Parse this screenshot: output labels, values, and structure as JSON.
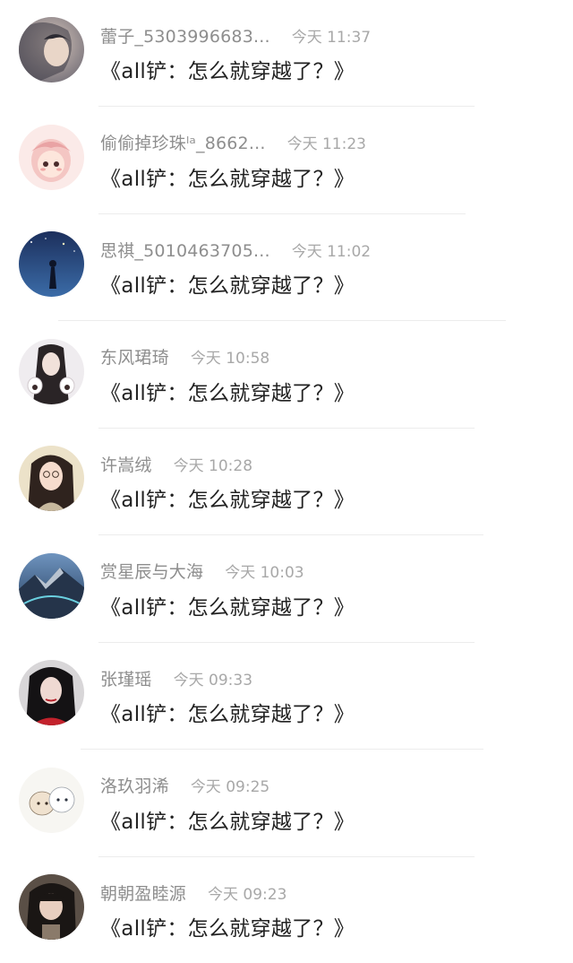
{
  "comments": [
    {
      "username": "蕾子_5303996683...",
      "time": "今天 11:37",
      "message": "《all铲：怎么就穿越了？》"
    },
    {
      "username": "偷偷掉珍珠ˡᵃ_8662...",
      "time": "今天 11:23",
      "message": "《all铲：怎么就穿越了？》"
    },
    {
      "username": "思祺_5010463705...",
      "time": "今天 11:02",
      "message": "《all铲：怎么就穿越了？》"
    },
    {
      "username": "东风珺琦",
      "time": "今天 10:58",
      "message": "《all铲：怎么就穿越了？》"
    },
    {
      "username": "许嵩绒",
      "time": "今天 10:28",
      "message": "《all铲：怎么就穿越了？》"
    },
    {
      "username": "赏星辰与大海",
      "time": "今天 10:03",
      "message": "《all铲：怎么就穿越了？》"
    },
    {
      "username": "张瑾瑶",
      "time": "今天 09:33",
      "message": "《all铲：怎么就穿越了？》"
    },
    {
      "username": "洛玖羽浠",
      "time": "今天 09:25",
      "message": "《all铲：怎么就穿越了？》"
    },
    {
      "username": "朝朝盈睦源",
      "time": "今天 09:23",
      "message": "《all铲：怎么就穿越了？》"
    }
  ]
}
